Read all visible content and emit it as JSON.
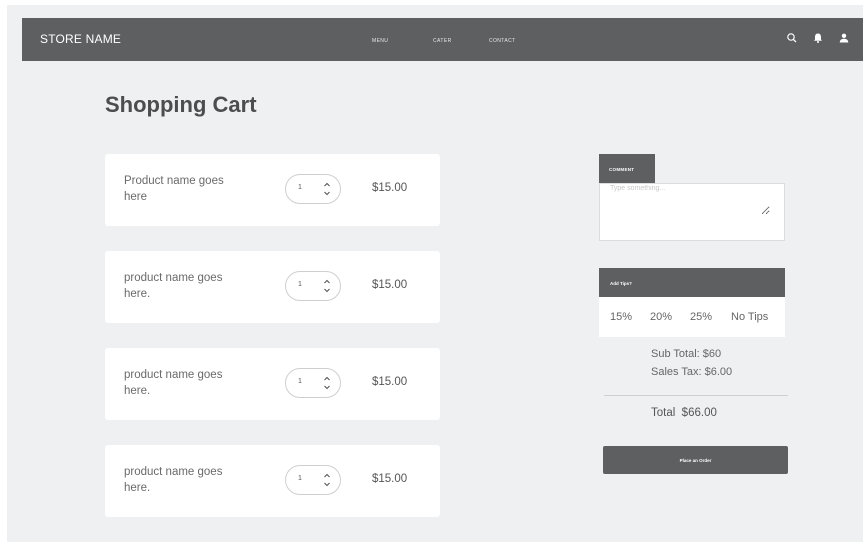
{
  "navbar": {
    "brand": "STORE NAME",
    "links": [
      "MENU",
      "CATER",
      "CONTACT"
    ],
    "icons": [
      "search-icon",
      "bell-icon",
      "user-icon"
    ]
  },
  "page": {
    "title": "Shopping Cart"
  },
  "cart": {
    "items": [
      {
        "name": "Product name goes here",
        "quantity": "1",
        "price": "$15.00"
      },
      {
        "name": "product name goes here.",
        "quantity": "1",
        "price": "$15.00"
      },
      {
        "name": "product name goes here.",
        "quantity": "1",
        "price": "$15.00"
      },
      {
        "name": "product name goes here.",
        "quantity": "1",
        "price": "$15.00"
      }
    ]
  },
  "comment": {
    "tab_label": "COMMENT",
    "placeholder": "Type something..."
  },
  "tips": {
    "header": "Add Tips?",
    "options": [
      "15%",
      "20%",
      "25%",
      "No Tips"
    ]
  },
  "summary": {
    "subtotal": "Sub Total: $60",
    "sales_tax": "Sales Tax: $6.00",
    "total": "Total  $66.00"
  },
  "order": {
    "button_label": "Place an Order"
  },
  "colors": {
    "navbar": "#5d5f61",
    "background": "#eef0f2",
    "card": "#ffffff"
  }
}
